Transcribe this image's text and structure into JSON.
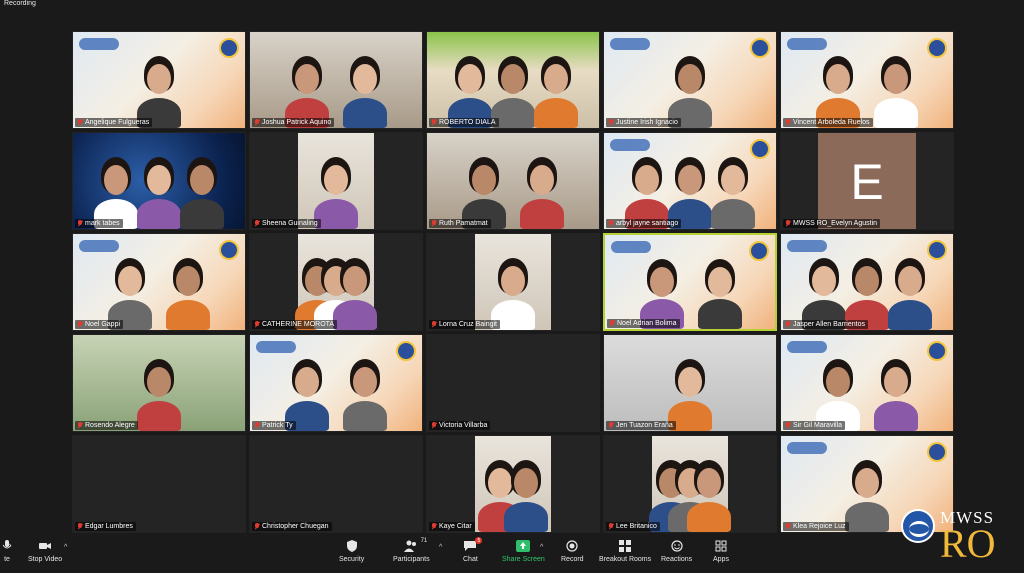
{
  "recording_label": "Recording",
  "tiles": [
    {
      "name": "Angelique Fulgueras",
      "bg": "event"
    },
    {
      "name": "Joshua Patrick Aquino",
      "bg": "room"
    },
    {
      "name": "ROBERTO DIALA",
      "bg": "home"
    },
    {
      "name": "Justine Irish Ignacio",
      "bg": "event"
    },
    {
      "name": "Vincent Arboleda Ruelos",
      "bg": "event"
    },
    {
      "name": "mark tabes",
      "bg": "blue"
    },
    {
      "name": "Sheena Guinaling",
      "bg": "dark"
    },
    {
      "name": "Ruth Pamatmat",
      "bg": "room"
    },
    {
      "name": "arbyl jayne santiago",
      "bg": "event"
    },
    {
      "name": "MWSS RO_Evelyn Agustin",
      "bg": "dark",
      "avatar": "E"
    },
    {
      "name": "Noel Gappi",
      "bg": "event"
    },
    {
      "name": "CATHERINE MOROTA",
      "bg": "dark"
    },
    {
      "name": "Lorna Cruz Baingit",
      "bg": "dark"
    },
    {
      "name": "Noel Adrian Bolima",
      "bg": "event",
      "active": true
    },
    {
      "name": "Jasper Allen Barrientos",
      "bg": "event"
    },
    {
      "name": "Rosendo Alegre",
      "bg": "green"
    },
    {
      "name": "Patrick Ty",
      "bg": "event"
    },
    {
      "name": "Victoria Villarba",
      "bg": "dark"
    },
    {
      "name": "Jen Tuazon Eraña",
      "bg": "grey"
    },
    {
      "name": "Sir Gil Maravilla",
      "bg": "event"
    },
    {
      "name": "Edgar  Lumbres",
      "bg": "dark"
    },
    {
      "name": "Christopher Chuegan",
      "bg": "dark"
    },
    {
      "name": "Kaye Citar",
      "bg": "dark"
    },
    {
      "name": "Lee Britanico",
      "bg": "dark"
    },
    {
      "name": "Klea Rejoice Luz",
      "bg": "event"
    }
  ],
  "toolbar": {
    "mute_label": "te",
    "stop_video": "Stop Video",
    "security": "Security",
    "participants": "Participants",
    "participants_count": "71",
    "chat": "Chat",
    "chat_badge": "5",
    "share_screen": "Share Screen",
    "record": "Record",
    "breakout_rooms": "Breakout Rooms",
    "reactions": "Reactions",
    "apps": "Apps"
  },
  "logo": {
    "line1": "MWSS",
    "line2": "RO"
  },
  "colors": {
    "active_speaker": "#b6d134",
    "muted_mic": "#e03b2f",
    "share_green": "#31c76a",
    "logo_gold": "#f0b93a",
    "logo_blue": "#2456a8"
  }
}
